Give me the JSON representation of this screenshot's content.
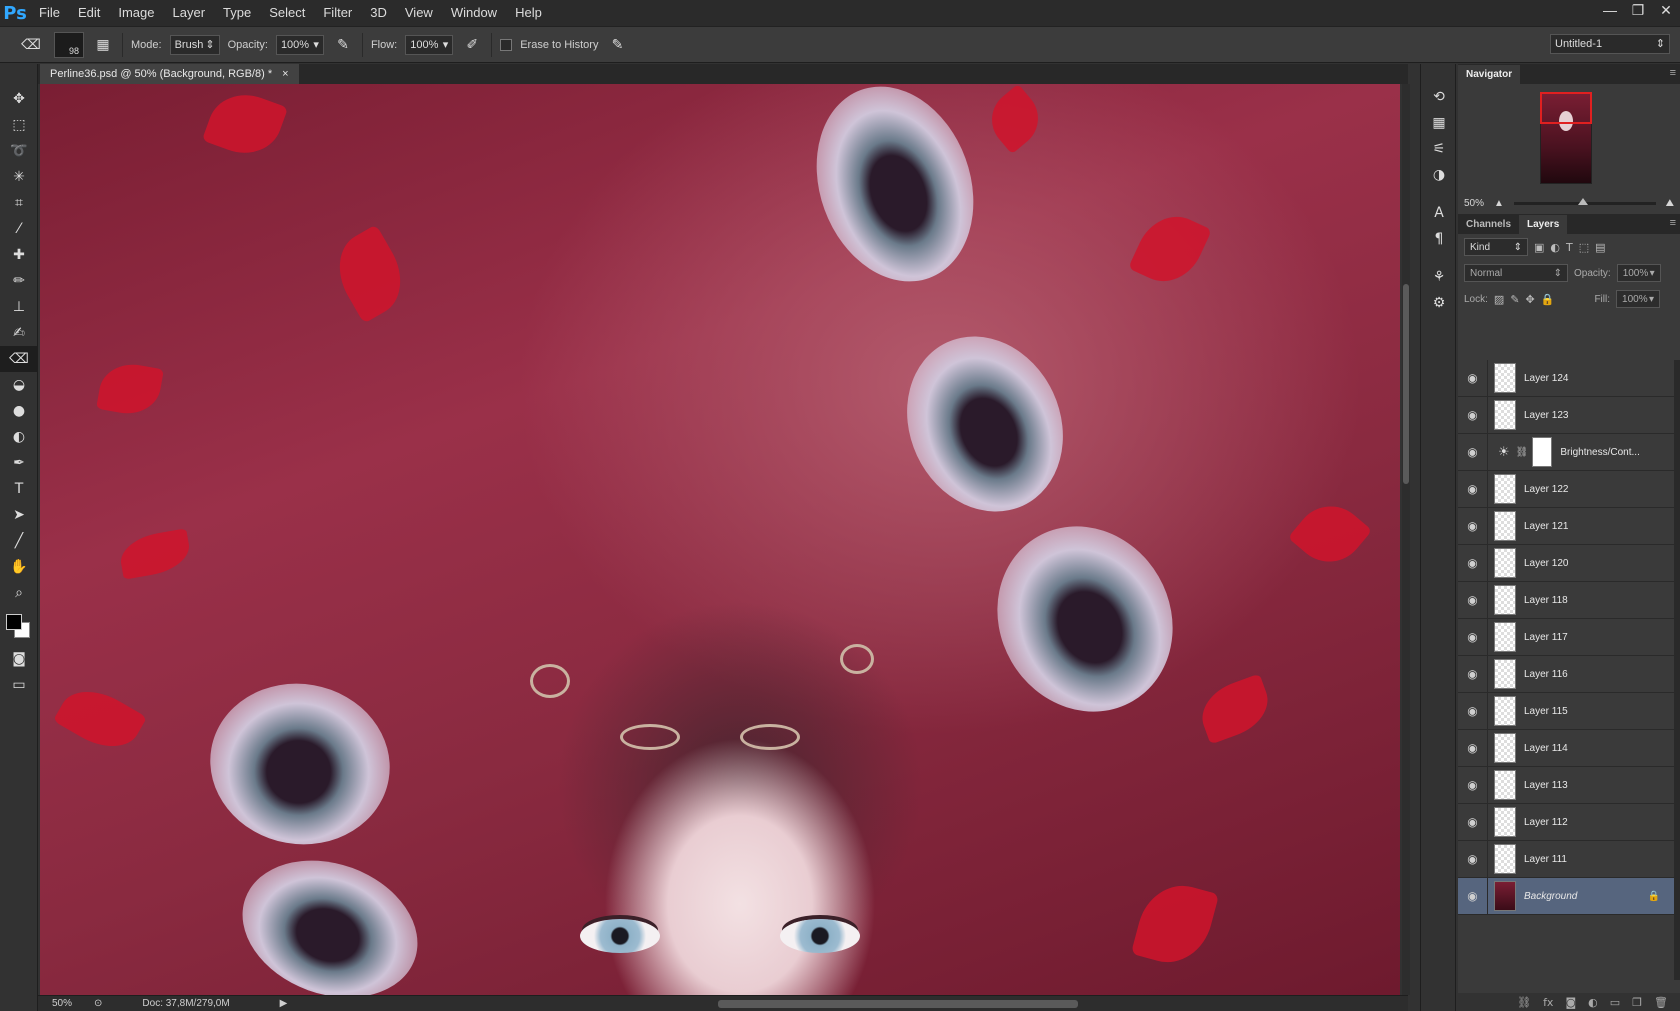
{
  "app": {
    "logo": "Ps"
  },
  "menu": [
    "File",
    "Edit",
    "Image",
    "Layer",
    "Type",
    "Select",
    "Filter",
    "3D",
    "View",
    "Window",
    "Help"
  ],
  "window_controls": [
    "—",
    "❐",
    "✕"
  ],
  "options": {
    "brush_size": "98",
    "mode_label": "Mode:",
    "mode_value": "Brush",
    "opacity_label": "Opacity:",
    "opacity_value": "100%",
    "flow_label": "Flow:",
    "flow_value": "100%",
    "erase_history_label": "Erase to History",
    "workspace_doc": "Untitled-1"
  },
  "document": {
    "tab_title": "Perline36.psd @ 50% (Background, RGB/8) *",
    "close": "×"
  },
  "status": {
    "zoom": "50%",
    "doc_info": "Doc: 37,8M/279,0M"
  },
  "navigator": {
    "tab": "Navigator",
    "zoom": "50%"
  },
  "layers_panel": {
    "tabs": [
      "Channels",
      "Layers"
    ],
    "active_tab": "Layers",
    "filter_kind": "Kind",
    "blend_mode": "Normal",
    "opacity_label": "Opacity:",
    "opacity_value": "100%",
    "lock_label": "Lock:",
    "fill_label": "Fill:",
    "fill_value": "100%",
    "layers": [
      {
        "name": "Layer 124"
      },
      {
        "name": "Layer 123"
      },
      {
        "name": "Brightness/Cont..."
      },
      {
        "name": "Layer 122"
      },
      {
        "name": "Layer 121"
      },
      {
        "name": "Layer 120"
      },
      {
        "name": "Layer 118"
      },
      {
        "name": "Layer 117"
      },
      {
        "name": "Layer 116"
      },
      {
        "name": "Layer 115"
      },
      {
        "name": "Layer 114"
      },
      {
        "name": "Layer 113"
      },
      {
        "name": "Layer 112"
      },
      {
        "name": "Layer 111"
      },
      {
        "name": "Background"
      }
    ]
  },
  "colors": {
    "selected_layer": "#56657e",
    "accent": "#31a8ff"
  }
}
